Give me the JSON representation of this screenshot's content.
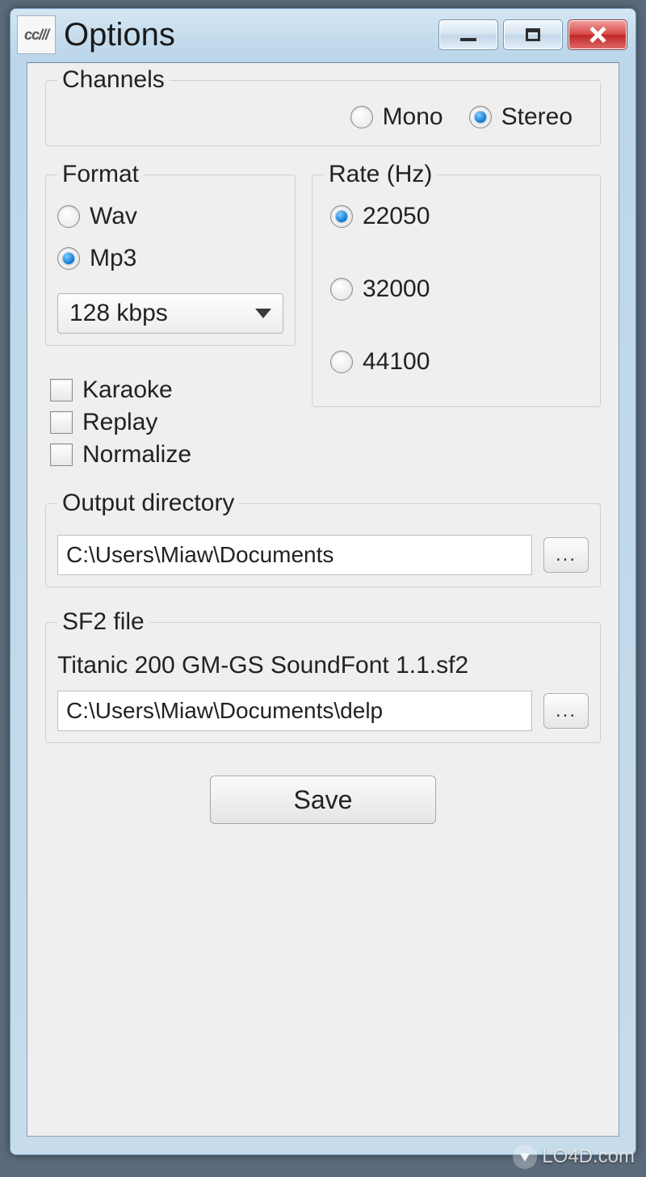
{
  "window": {
    "title": "Options"
  },
  "channels": {
    "legend": "Channels",
    "mono_label": "Mono",
    "stereo_label": "Stereo",
    "selected": "stereo"
  },
  "format": {
    "legend": "Format",
    "wav_label": "Wav",
    "mp3_label": "Mp3",
    "selected": "mp3",
    "bitrate_selected": "128 kbps"
  },
  "rate": {
    "legend": "Rate (Hz)",
    "opt1_label": "22050",
    "opt2_label": "32000",
    "opt3_label": "44100",
    "selected": "22050"
  },
  "checks": {
    "karaoke_label": "Karaoke",
    "replay_label": "Replay",
    "normalize_label": "Normalize"
  },
  "output": {
    "legend": "Output directory",
    "path": "C:\\Users\\Miaw\\Documents",
    "browse_label": "..."
  },
  "sf2": {
    "legend": "SF2 file",
    "name": "Titanic 200 GM-GS SoundFont 1.1.sf2",
    "path": "C:\\Users\\Miaw\\Documents\\delp",
    "browse_label": "..."
  },
  "buttons": {
    "save": "Save"
  },
  "watermark": "LO4D.com"
}
